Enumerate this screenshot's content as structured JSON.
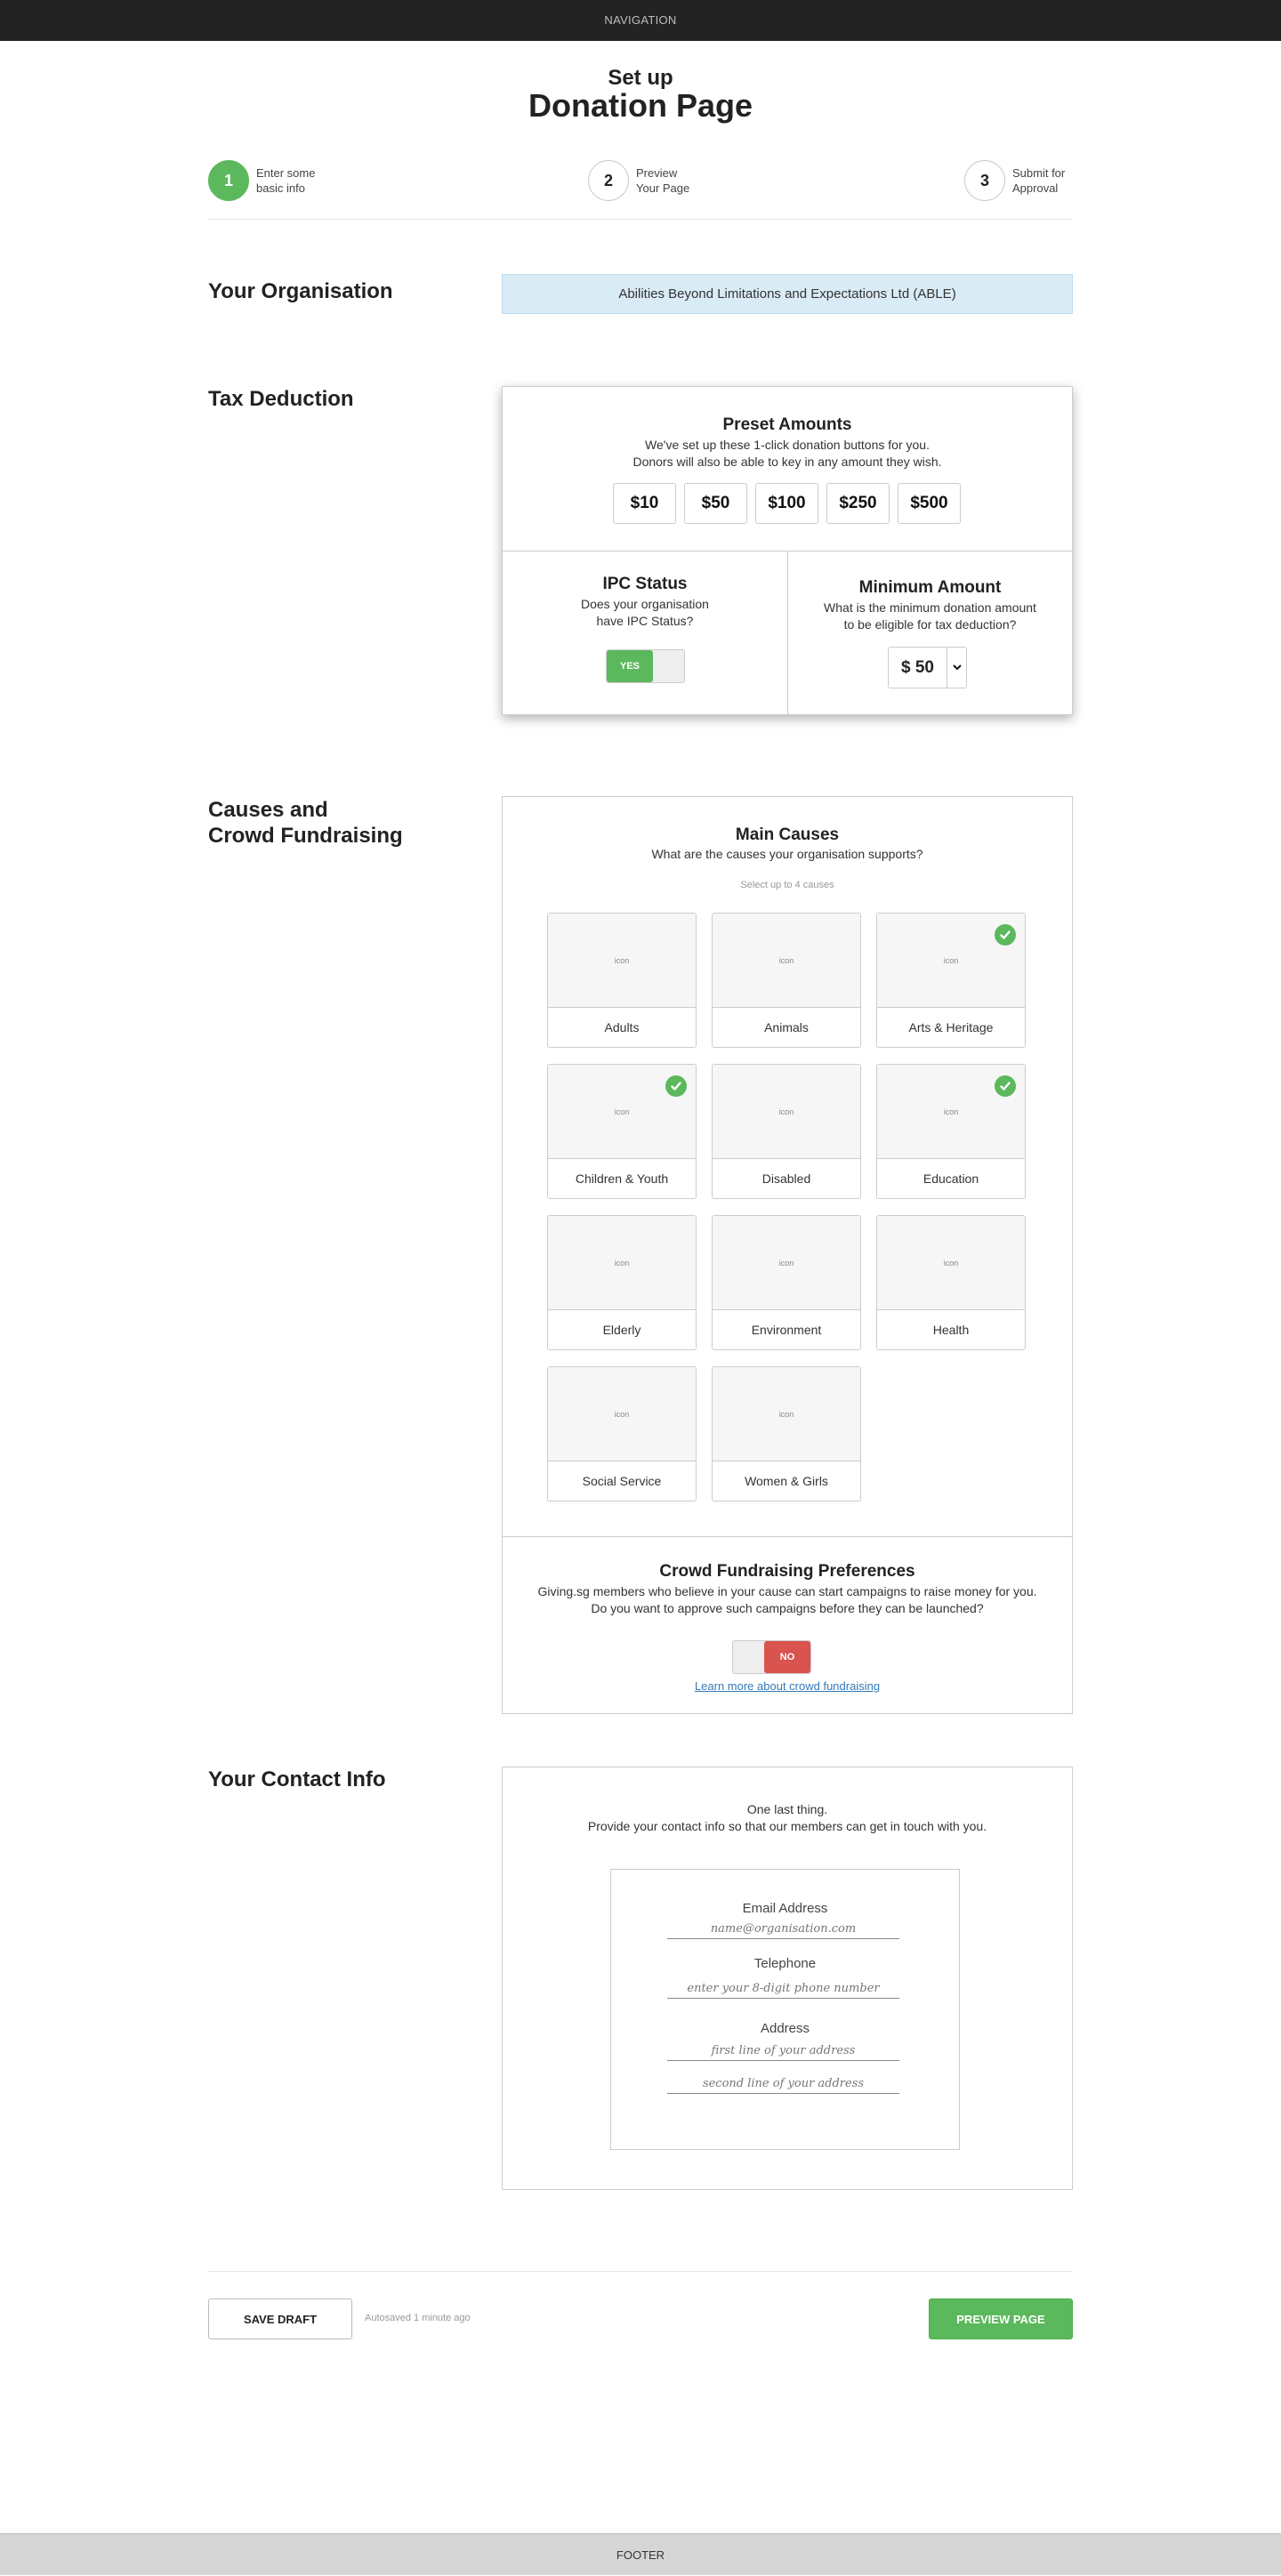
{
  "nav": {
    "label": "NAVIGATION"
  },
  "header": {
    "title_small": "Set up",
    "title_big": "Donation Page"
  },
  "steps": [
    {
      "number": "1",
      "text": "Enter some\nbasic info",
      "active": true
    },
    {
      "number": "2",
      "text": "Preview\nYour Page",
      "active": false
    },
    {
      "number": "3",
      "text": "Submit for\nApproval",
      "active": false
    }
  ],
  "organisation": {
    "section_title": "Your Organisation",
    "name": "Abilities Beyond Limitations and Expectations Ltd (ABLE)"
  },
  "tax": {
    "section_title": "Tax Deduction",
    "preset_heading": "Preset Amounts",
    "preset_sub": "We've set up these 1-click donation buttons for you.\nDonors will also be able to key in any amount they wish.",
    "amounts": [
      "$10",
      "$50",
      "$100",
      "$250",
      "$500"
    ],
    "ipc_heading": "IPC Status",
    "ipc_sub": "Does your organisation\nhave IPC Status?",
    "ipc_toggle_label": "YES",
    "min_heading": "Minimum Amount",
    "min_sub": "What is the minimum donation amount\nto be eligible for tax deduction?",
    "min_value": "$ 50",
    "accent_green": "#5cb85c"
  },
  "causes": {
    "section_title": "Causes and\nCrowd Fundraising",
    "heading": "Main Causes",
    "sub": "What are the causes your organisation supports?",
    "hint": "Select up to 4 causes",
    "icon_placeholder": "icon",
    "items": [
      {
        "label": "Adults",
        "selected": false
      },
      {
        "label": "Animals",
        "selected": false
      },
      {
        "label": "Arts & Heritage",
        "selected": true
      },
      {
        "label": "Children & Youth",
        "selected": true
      },
      {
        "label": "Disabled",
        "selected": false
      },
      {
        "label": "Education",
        "selected": true
      },
      {
        "label": "Elderly",
        "selected": false
      },
      {
        "label": "Environment",
        "selected": false
      },
      {
        "label": "Health",
        "selected": false
      },
      {
        "label": "Social Service",
        "selected": false
      },
      {
        "label": "Women & Girls",
        "selected": false
      }
    ],
    "crowd_heading": "Crowd Fundraising Preferences",
    "crowd_sub": "Giving.sg members who believe in your cause can start campaigns to raise money for you.\nDo you want to approve  such campaigns before they can be launched?",
    "crowd_toggle_label": "NO",
    "learn_more": "Learn more about crowd fundraising",
    "accent_red": "#d9534f"
  },
  "contact": {
    "section_title": "Your Contact Info",
    "intro_line1": "One last thing.",
    "intro_line2": "Provide your contact info so that our members can get in touch with you.",
    "email_label": "Email Address",
    "email_placeholder": "name@organisation.com",
    "phone_label": "Telephone",
    "phone_placeholder": "enter your 8-digit phone number",
    "address_label": "Address",
    "address1_placeholder": "first line of your address",
    "address2_placeholder": "second line of your address"
  },
  "actions": {
    "save_label": "SAVE DRAFT",
    "autosave_text": "Autosaved 1 minute ago",
    "preview_label": "PREVIEW PAGE"
  },
  "footer": {
    "label": "FOOTER"
  }
}
